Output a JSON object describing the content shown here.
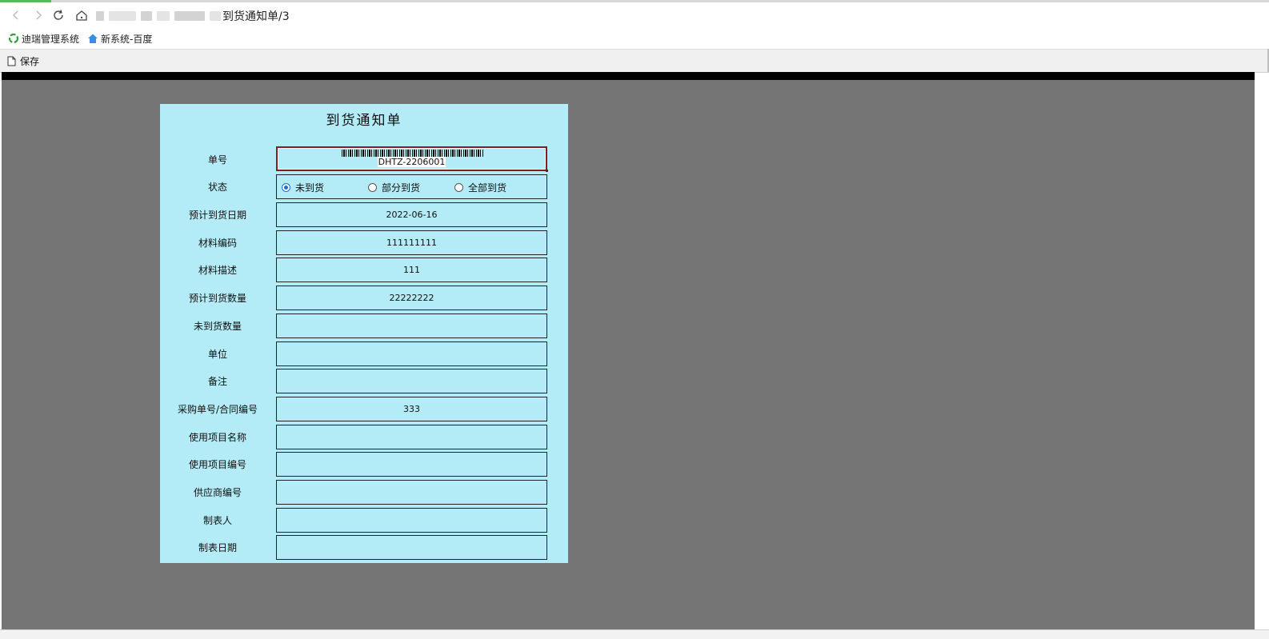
{
  "browser": {
    "address_title": "到货通知单/3",
    "bookmarks": [
      {
        "label": "迪瑞管理系统",
        "icon": "recycle-icon"
      },
      {
        "label": "新系统-百度",
        "icon": "home-icon"
      }
    ]
  },
  "toolbar": {
    "save_label": "保存"
  },
  "form": {
    "title": "到货通知单",
    "barcode_label": "单号",
    "barcode_value": "DHTZ-2206001",
    "status": {
      "label": "状态",
      "options": [
        "未到货",
        "部分到货",
        "全部到货"
      ],
      "selected": "未到货"
    },
    "fields": [
      {
        "label": "预计到货日期",
        "value": "2022-06-16"
      },
      {
        "label": "材料编码",
        "value": "111111111"
      },
      {
        "label": "材料描述",
        "value": "111"
      },
      {
        "label": "预计到货数量",
        "value": "22222222"
      },
      {
        "label": "未到货数量",
        "value": ""
      },
      {
        "label": "单位",
        "value": ""
      },
      {
        "label": "备注",
        "value": ""
      },
      {
        "label": "采购单号/合同编号",
        "value": "333"
      },
      {
        "label": "使用项目名称",
        "value": ""
      },
      {
        "label": "使用项目编号",
        "value": ""
      },
      {
        "label": "供应商编号",
        "value": ""
      },
      {
        "label": "制表人",
        "value": ""
      },
      {
        "label": "制表日期",
        "value": ""
      }
    ]
  },
  "colors": {
    "form_bg": "#b3ebf6",
    "viewport_bg": "#757575",
    "radio_accent": "#1f6fd0"
  }
}
